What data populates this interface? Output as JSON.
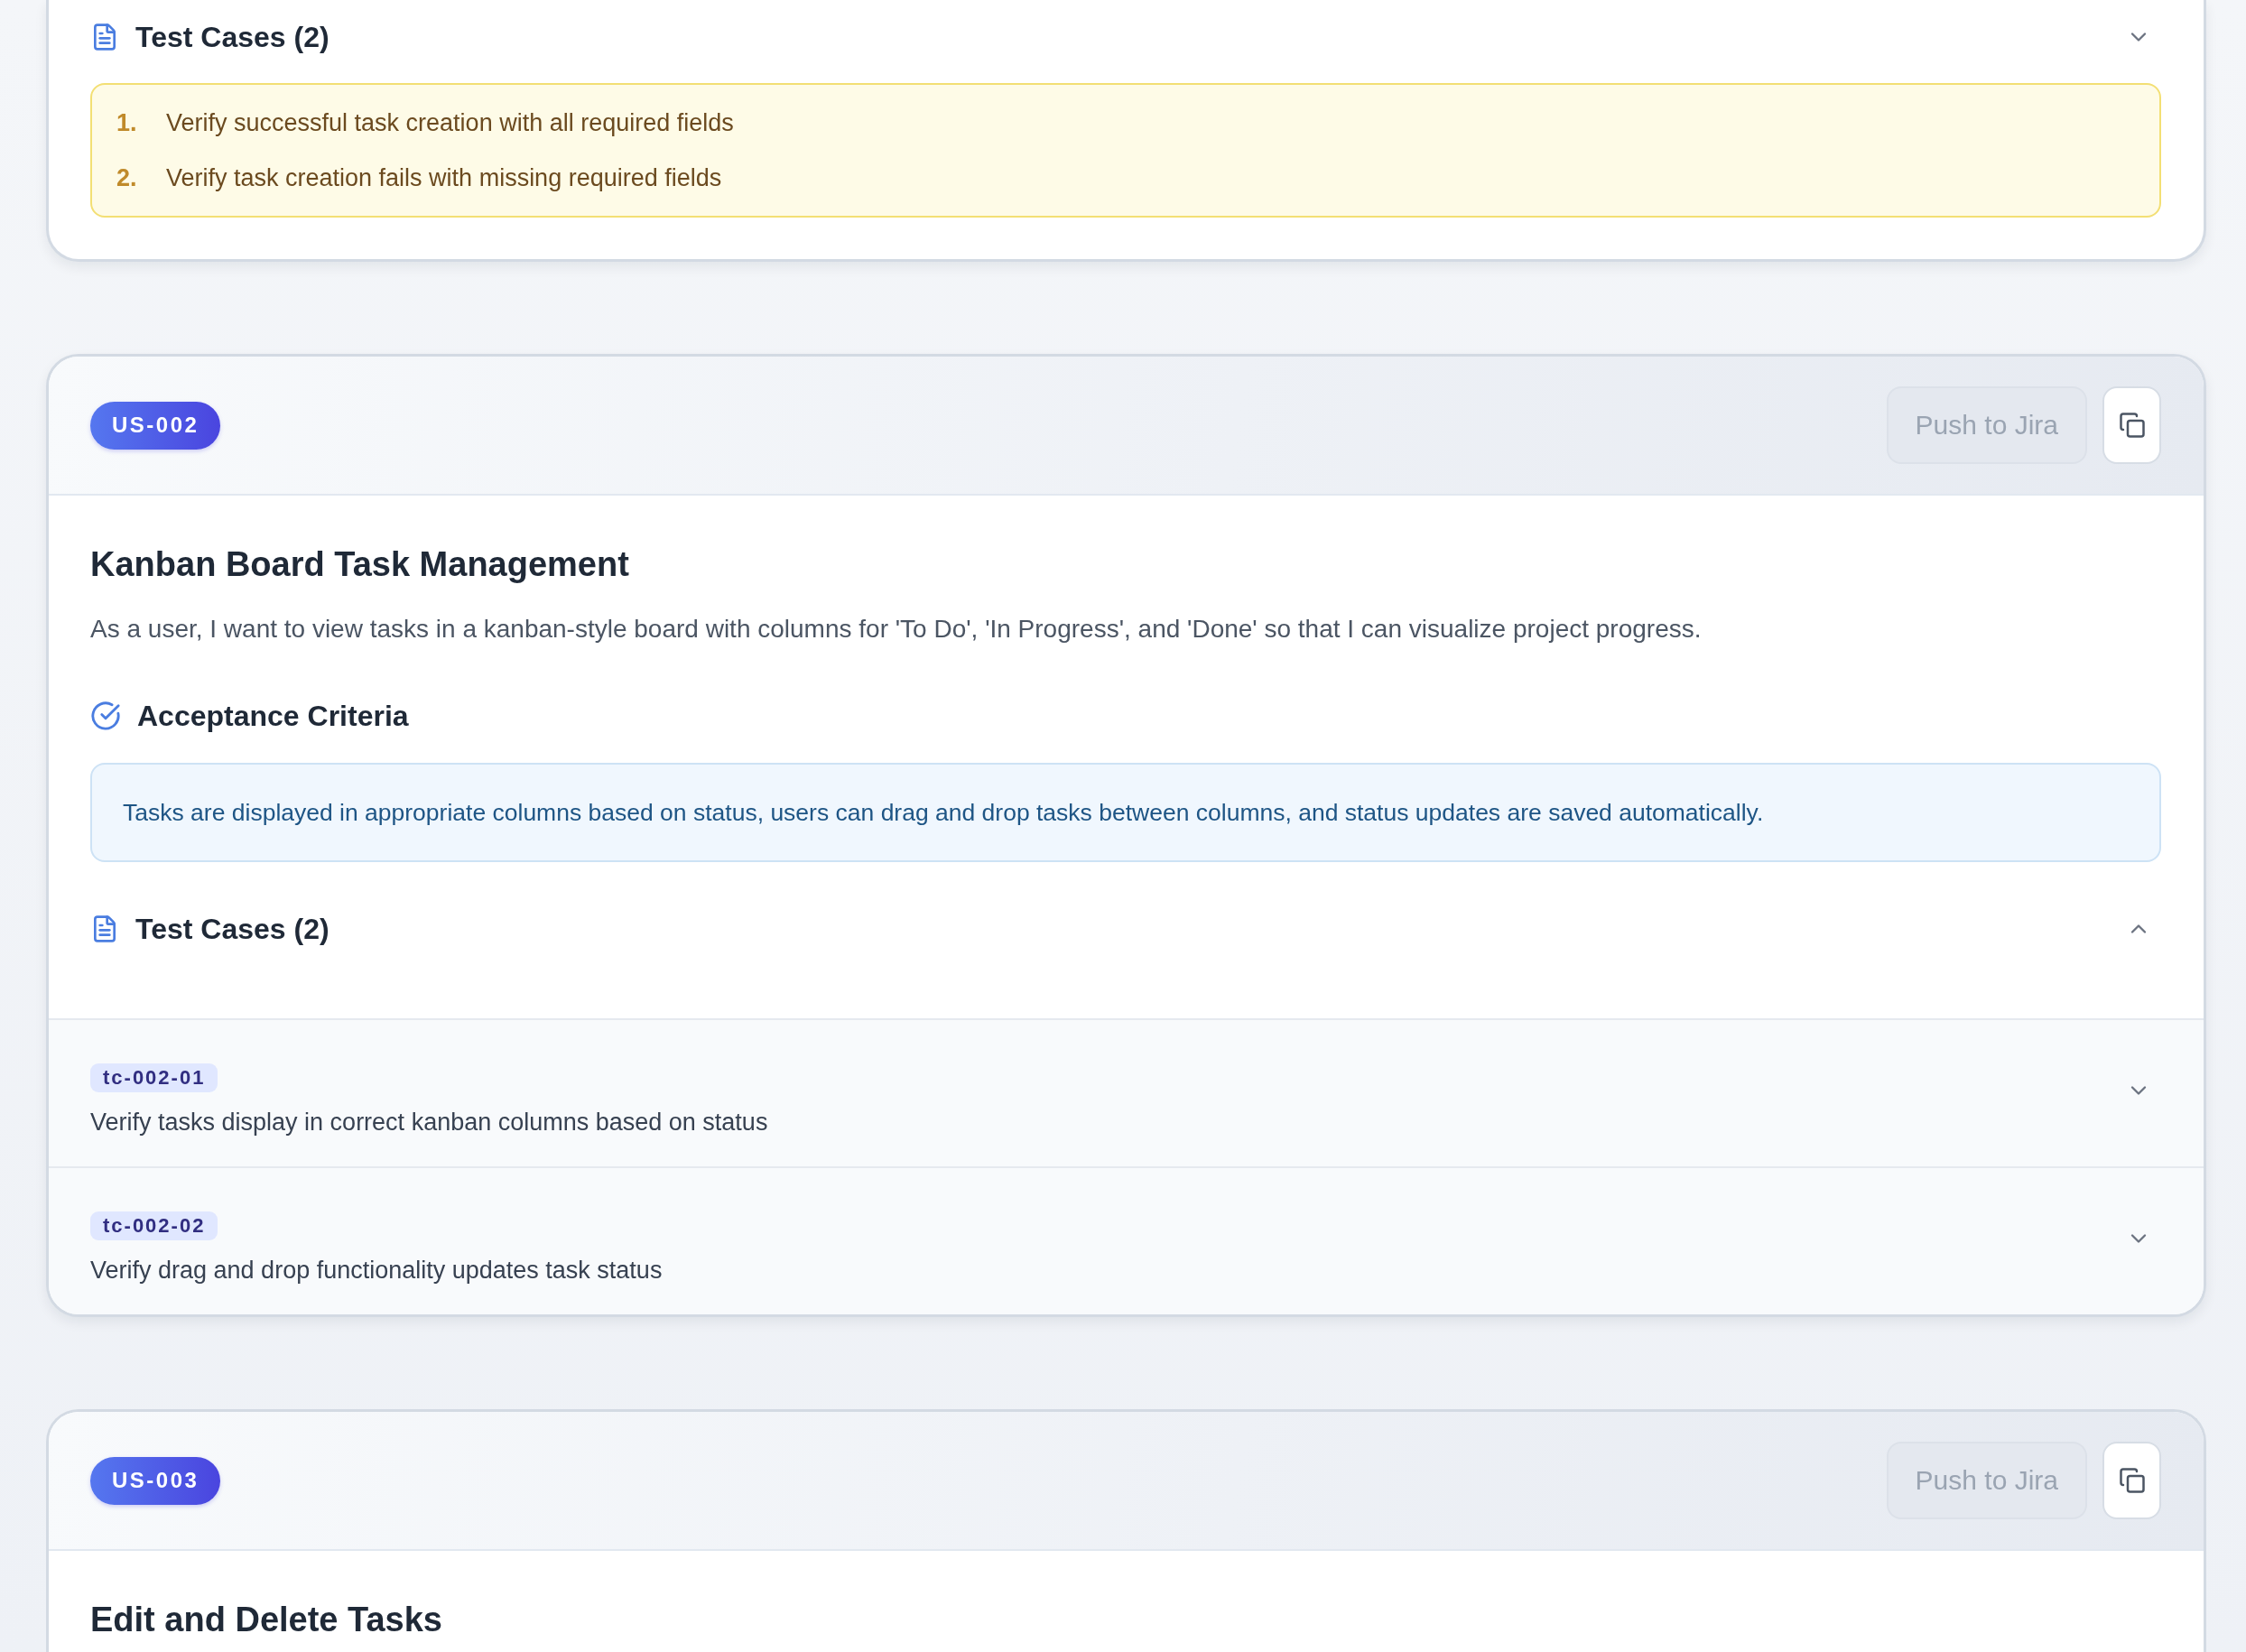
{
  "stories": [
    {
      "test_cases": {
        "label": "Test Cases (2)",
        "expanded": false,
        "cases": [
          {
            "number": "1.",
            "title": "Verify successful task creation with all required fields"
          },
          {
            "number": "2.",
            "title": "Verify task creation fails with missing required fields"
          }
        ]
      }
    },
    {
      "id": "US-002",
      "push_button": {
        "label": "Push to Jira",
        "disabled": true
      },
      "title": "Kanban Board Task Management",
      "description": "As a user, I want to view tasks in a kanban-style board with columns for 'To Do', 'In Progress', and 'Done' so that I can visualize project progress.",
      "acceptance": {
        "label": "Acceptance Criteria",
        "text": "Tasks are displayed in appropriate columns based on status, users can drag and drop tasks between columns, and status updates are saved automatically."
      },
      "test_cases": {
        "label": "Test Cases (2)",
        "expanded": true,
        "cases": [
          {
            "id": "tc-002-01",
            "title": "Verify tasks display in correct kanban columns based on status",
            "expanded": false
          },
          {
            "id": "tc-002-02",
            "title": "Verify drag and drop functionality updates task status",
            "expanded": false
          }
        ]
      }
    },
    {
      "id": "US-003",
      "push_button": {
        "label": "Push to Jira",
        "disabled": true
      },
      "title": "Edit and Delete Tasks"
    }
  ]
}
